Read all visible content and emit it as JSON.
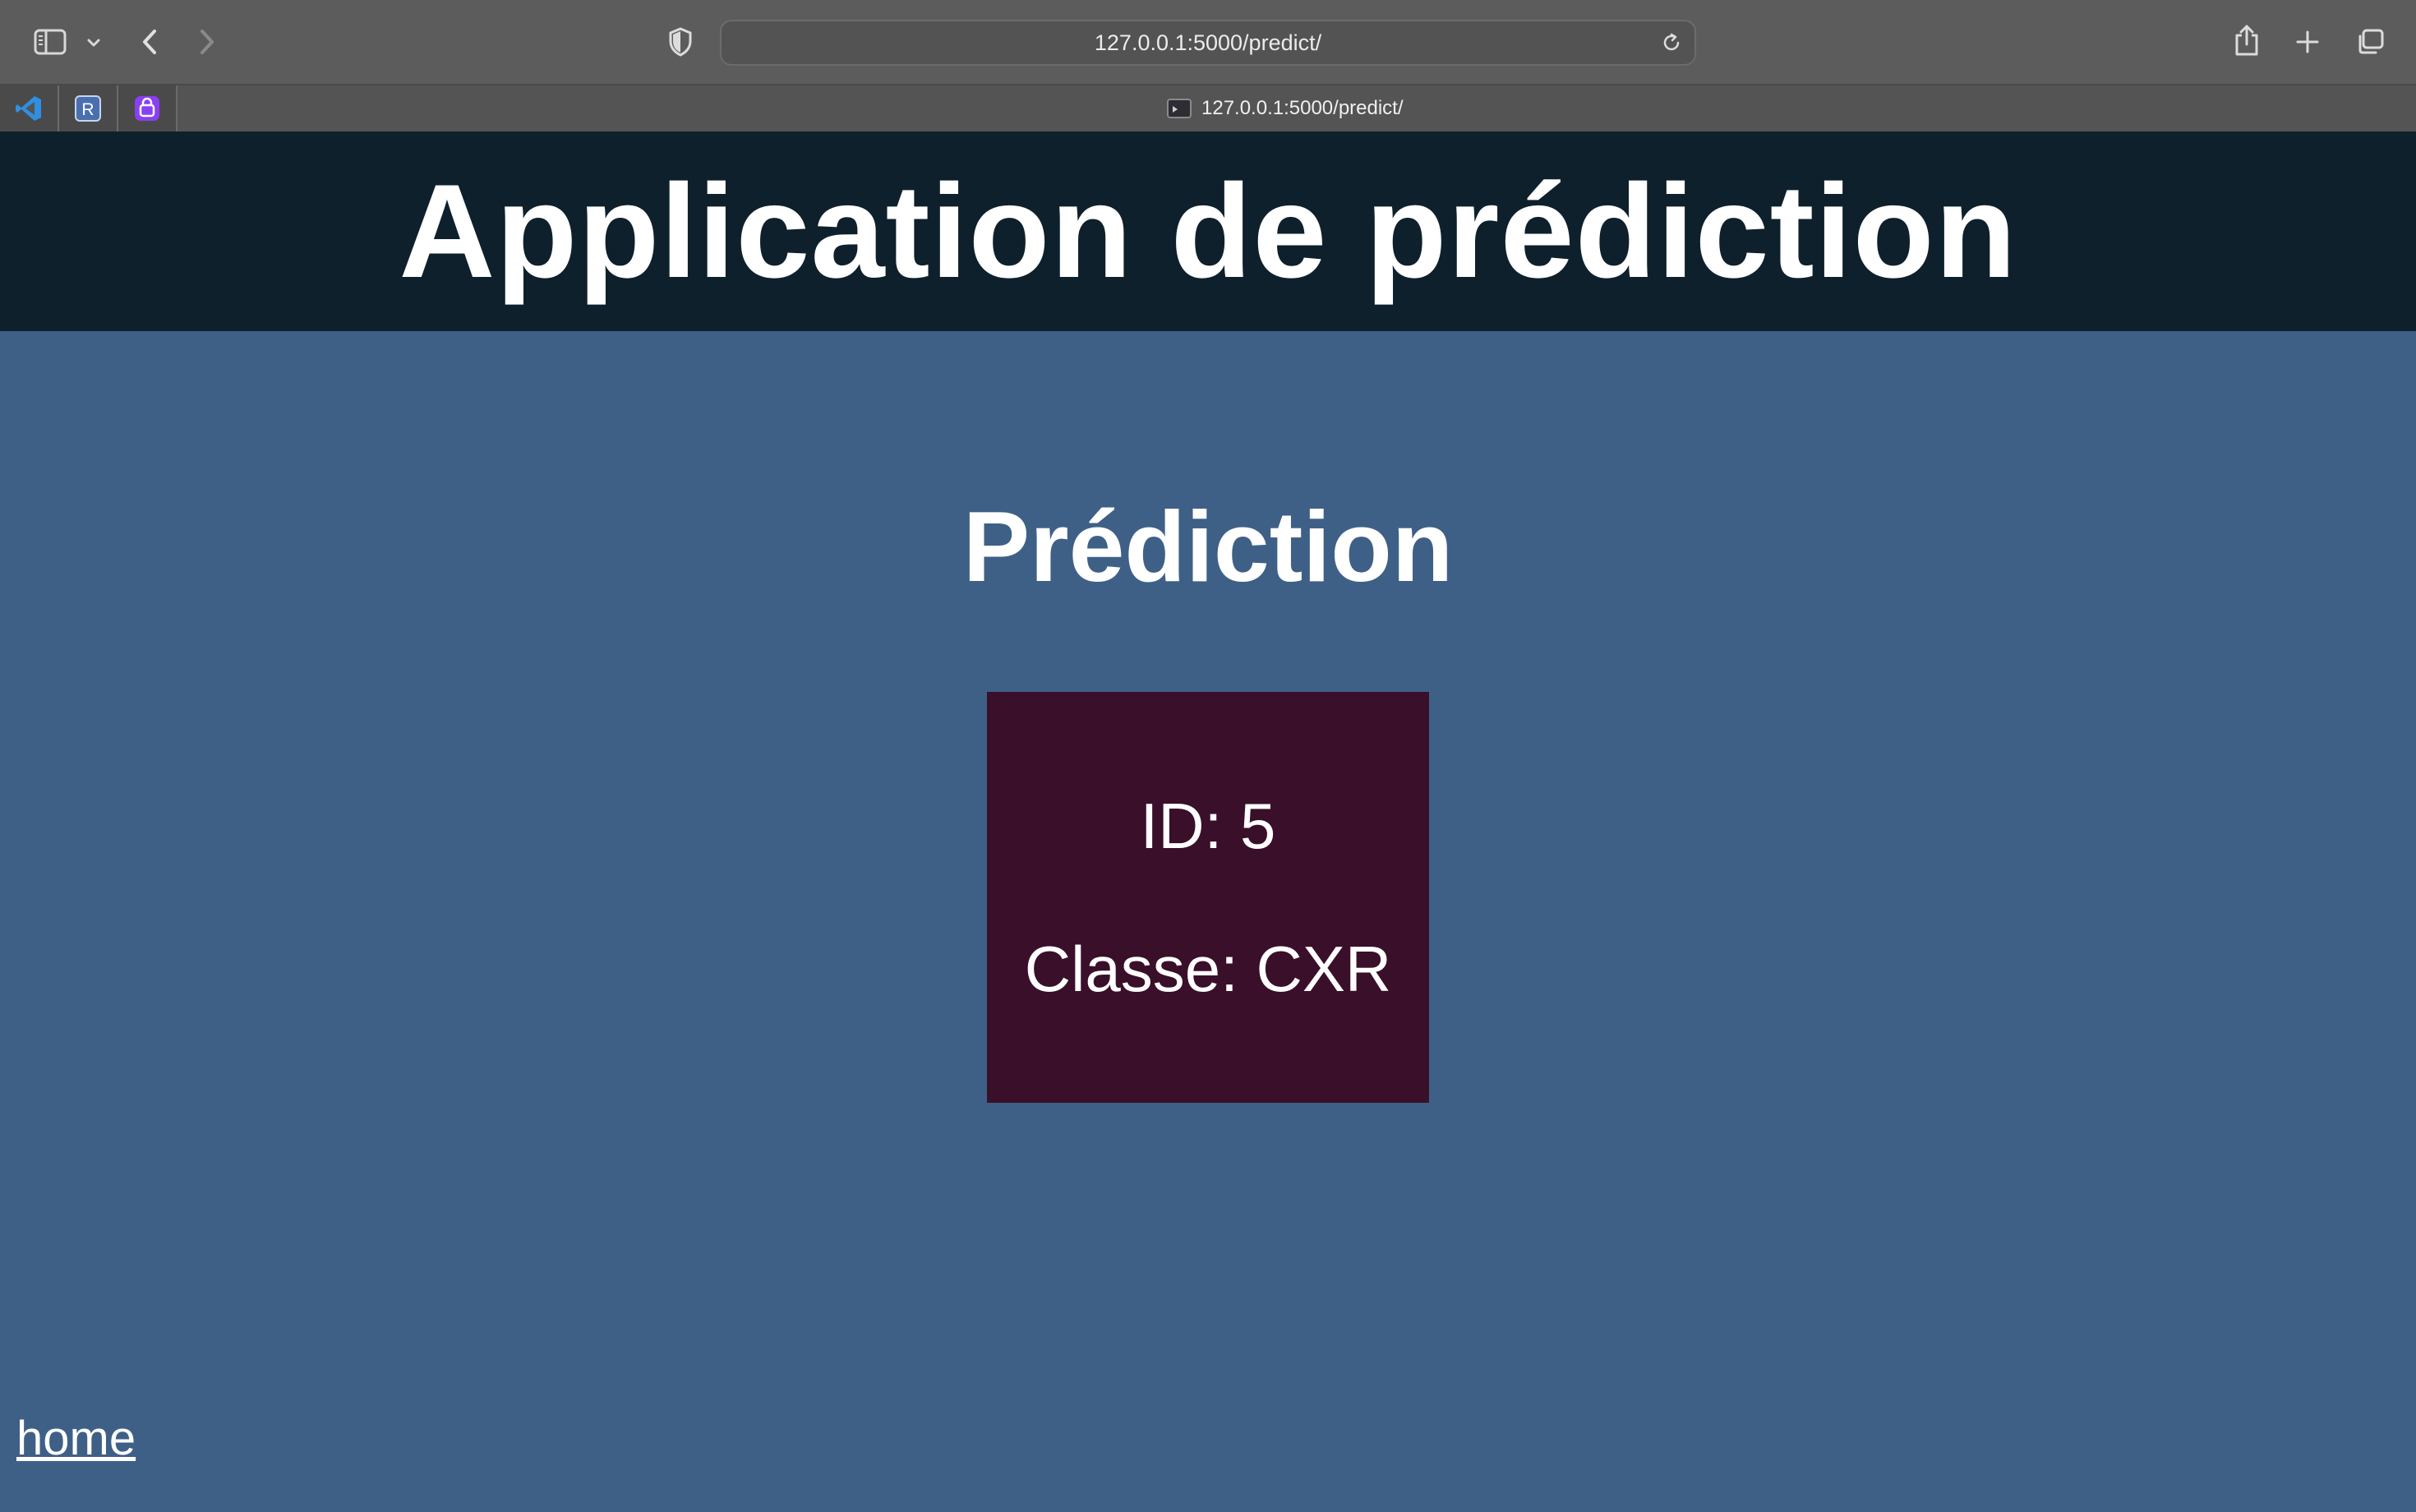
{
  "browser": {
    "url": "127.0.0.1:5000/predict/",
    "tab_title": "127.0.0.1:5000/predict/",
    "pinned_tabs": [
      {
        "icon": "vscode-icon",
        "color": "#2f8fe0"
      },
      {
        "icon": "r-icon",
        "label": "R",
        "color": "#4a6fb0"
      },
      {
        "icon": "proton-vpn-icon",
        "color": "#8a3ff0"
      }
    ]
  },
  "page": {
    "title": "Application de prédiction",
    "heading": "Prédiction",
    "result": {
      "id_line": "ID: 5",
      "class_line": "Classe: CXR"
    },
    "home_link": "home"
  },
  "colors": {
    "header_bg": "#0e202b",
    "page_bg": "#3e6087",
    "card_bg": "#3a0f29"
  }
}
